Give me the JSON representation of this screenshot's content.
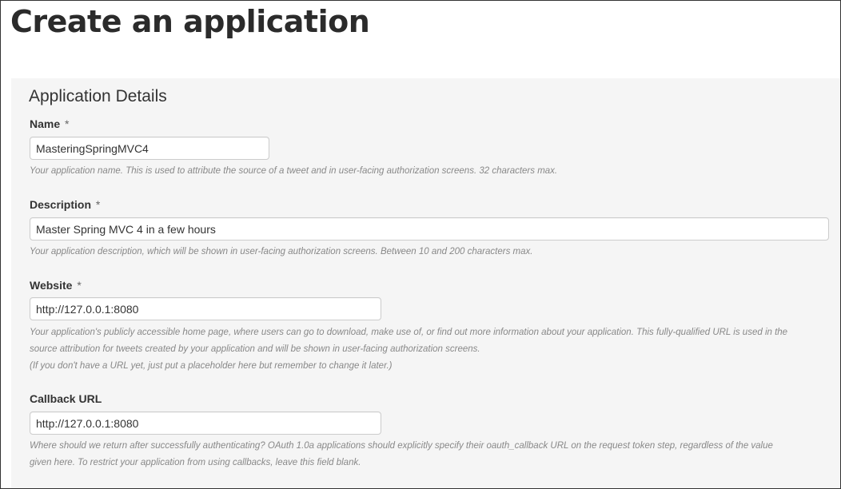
{
  "page": {
    "title": "Create an application"
  },
  "section": {
    "title": "Application Details"
  },
  "required_marker": "*",
  "fields": {
    "name": {
      "label": "Name",
      "value": "MasteringSpringMVC4",
      "help": "Your application name. This is used to attribute the source of a tweet and in user-facing authorization screens. 32 characters max."
    },
    "description": {
      "label": "Description",
      "value": "Master Spring MVC 4 in a few hours",
      "help": "Your application description, which will be shown in user-facing authorization screens. Between 10 and 200 characters max."
    },
    "website": {
      "label": "Website",
      "value": "http://127.0.0.1:8080",
      "help_lines": [
        "Your application's publicly accessible home page, where users can go to download, make use of, or find out more information about your application. This fully-qualified URL is used in the",
        "source attribution for tweets created by your application and will be shown in user-facing authorization screens.",
        "(If you don't have a URL yet, just put a placeholder here but remember to change it later.)"
      ]
    },
    "callback_url": {
      "label": "Callback URL",
      "value": "http://127.0.0.1:8080",
      "help_lines": [
        "Where should we return after successfully authenticating? OAuth 1.0a applications should explicitly specify their oauth_callback URL on the request token step, regardless of the value",
        "given here. To restrict your application from using callbacks, leave this field blank."
      ]
    }
  },
  "colors": {
    "panel_background": "#f5f5f5",
    "title_text": "#2b2b2b",
    "help_text": "#888888",
    "input_border": "#cccccc"
  }
}
